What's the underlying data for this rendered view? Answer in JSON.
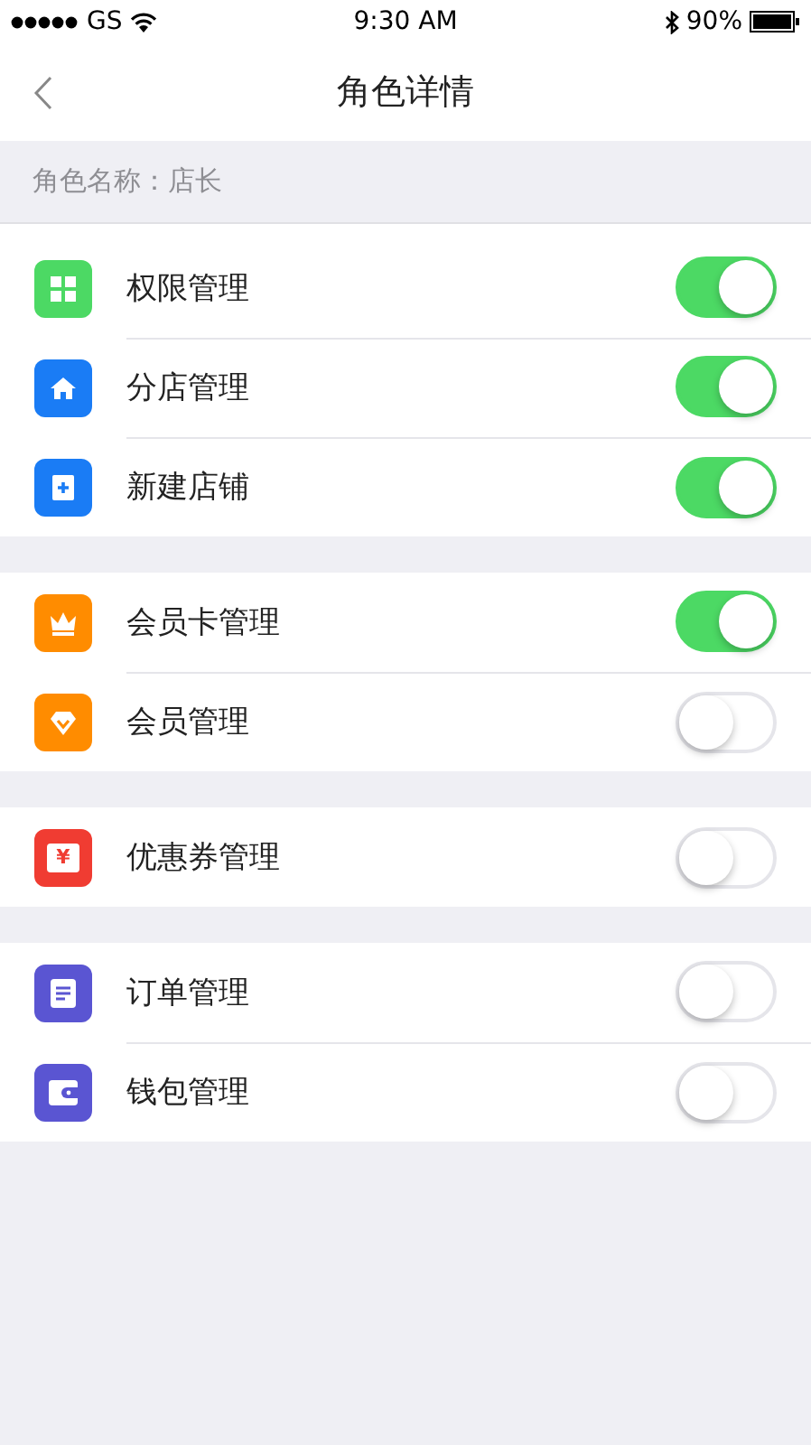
{
  "status_bar": {
    "carrier": "GS",
    "time": "9:30 AM",
    "battery": "90%"
  },
  "nav": {
    "title": "角色详情"
  },
  "role_name": "角色名称：店长",
  "groups": [
    {
      "items": [
        {
          "label": "权限管理",
          "kind": "grid",
          "color": "#4cd964",
          "on": true
        },
        {
          "label": "分店管理",
          "kind": "house",
          "color": "#1a7cf5",
          "on": true
        },
        {
          "label": "新建店铺",
          "kind": "plus",
          "color": "#1a7cf5",
          "on": true
        }
      ]
    },
    {
      "items": [
        {
          "label": "会员卡管理",
          "kind": "crown",
          "color": "#ff8c00",
          "on": true
        },
        {
          "label": "会员管理",
          "kind": "diamond",
          "color": "#ff8c00",
          "on": false
        }
      ]
    },
    {
      "items": [
        {
          "label": "优惠券管理",
          "kind": "coupon",
          "color": "#f03c32",
          "on": false,
          "icon_glyph": "¥"
        }
      ]
    },
    {
      "items": [
        {
          "label": "订单管理",
          "kind": "doc",
          "color": "#5a55d2",
          "on": false
        },
        {
          "label": "钱包管理",
          "kind": "wallet",
          "color": "#5a55d2",
          "on": false
        }
      ]
    }
  ]
}
